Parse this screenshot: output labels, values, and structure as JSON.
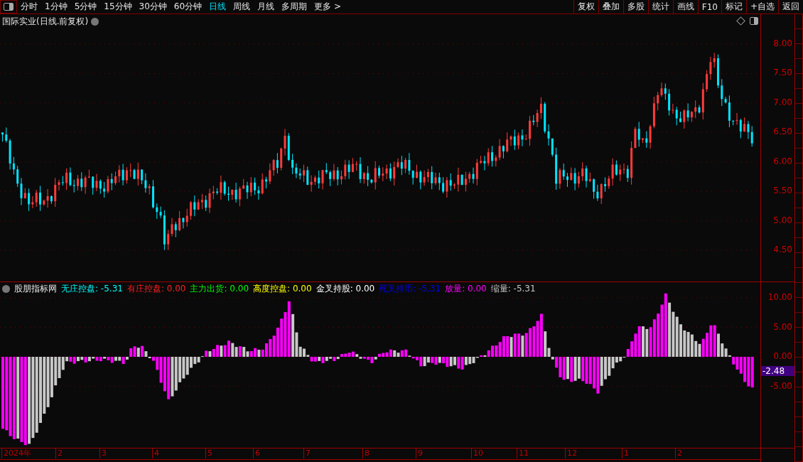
{
  "toolbar": {
    "periods": [
      {
        "label": "分时",
        "selected": false
      },
      {
        "label": "1分钟",
        "selected": false
      },
      {
        "label": "5分钟",
        "selected": false
      },
      {
        "label": "15分钟",
        "selected": false
      },
      {
        "label": "30分钟",
        "selected": false
      },
      {
        "label": "60分钟",
        "selected": false
      },
      {
        "label": "日线",
        "selected": true
      },
      {
        "label": "周线",
        "selected": false
      },
      {
        "label": "月线",
        "selected": false
      },
      {
        "label": "多周期",
        "selected": false
      },
      {
        "label": "更多 >",
        "selected": false
      }
    ],
    "actions": [
      "复权",
      "叠加",
      "多股",
      "统计",
      "画线",
      "F10",
      "标记",
      "+自选",
      "返回"
    ]
  },
  "price_chart": {
    "title": "国际实业(日线.前复权)",
    "price_axis": [
      "8.00",
      "7.50",
      "7.00",
      "6.50",
      "6.00",
      "5.50",
      "5.00",
      "4.50"
    ]
  },
  "indicator": {
    "name": "股朋指标网",
    "legend": [
      {
        "label": "无庄控盘:",
        "value": "-5.31",
        "color": "#00ffff"
      },
      {
        "label": "有庄控盘:",
        "value": "0.00",
        "color": "#ff2020"
      },
      {
        "label": "主力出货:",
        "value": "0.00",
        "color": "#00ff00"
      },
      {
        "label": "高度控盘:",
        "value": "0.00",
        "color": "#ffff00"
      },
      {
        "label": "金叉持股:",
        "value": "0.00",
        "color": "#ffffff"
      },
      {
        "label": "死叉持币:",
        "value": "-5.31",
        "color": "#0000ff"
      },
      {
        "label": "放量:",
        "value": "0.00",
        "color": "#ff00ff"
      },
      {
        "label": "缩量:",
        "value": "-5.31",
        "color": "#c8c8c8"
      }
    ],
    "axis": [
      "10.00",
      "5.00",
      "0.00",
      "-5.00"
    ],
    "current_value": "-2.48"
  },
  "date_axis": [
    "2024年",
    "2",
    "3",
    "4",
    "5",
    "6",
    "7",
    "8",
    "9",
    "10",
    "11",
    "12",
    "1",
    "2"
  ]
}
